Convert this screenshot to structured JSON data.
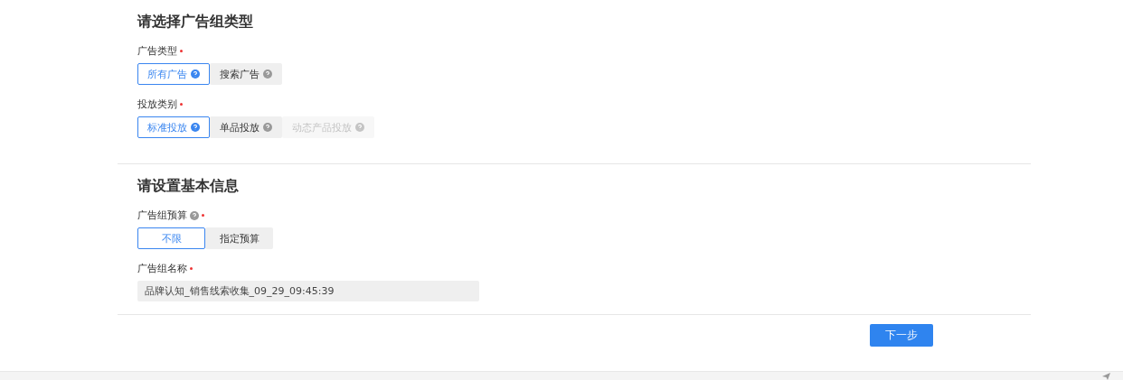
{
  "sections": [
    {
      "title": "请选择广告组类型",
      "fields": [
        {
          "label": "广告类型",
          "required": true,
          "help": false,
          "kind": "segmented",
          "options": [
            {
              "label": "所有广告",
              "help": true,
              "selected": true,
              "disabled": false
            },
            {
              "label": "搜索广告",
              "help": true,
              "selected": false,
              "disabled": false
            }
          ]
        },
        {
          "label": "投放类别",
          "required": true,
          "help": false,
          "kind": "segmented",
          "options": [
            {
              "label": "标准投放",
              "help": true,
              "selected": true,
              "disabled": false
            },
            {
              "label": "单品投放",
              "help": true,
              "selected": false,
              "disabled": false
            },
            {
              "label": "动态产品投放",
              "help": true,
              "selected": false,
              "disabled": true
            }
          ]
        }
      ]
    },
    {
      "title": "请设置基本信息",
      "fields": [
        {
          "label": "广告组预算",
          "required": true,
          "help": true,
          "kind": "segmented",
          "options": [
            {
              "label": "不限",
              "help": false,
              "selected": true,
              "disabled": false
            },
            {
              "label": "指定预算",
              "help": false,
              "selected": false,
              "disabled": false
            }
          ]
        },
        {
          "label": "广告组名称",
          "required": true,
          "help": false,
          "kind": "text",
          "value": "品牌认知_销售线索收集_09_29_09:45:39"
        }
      ]
    }
  ],
  "next_button": "下一步"
}
